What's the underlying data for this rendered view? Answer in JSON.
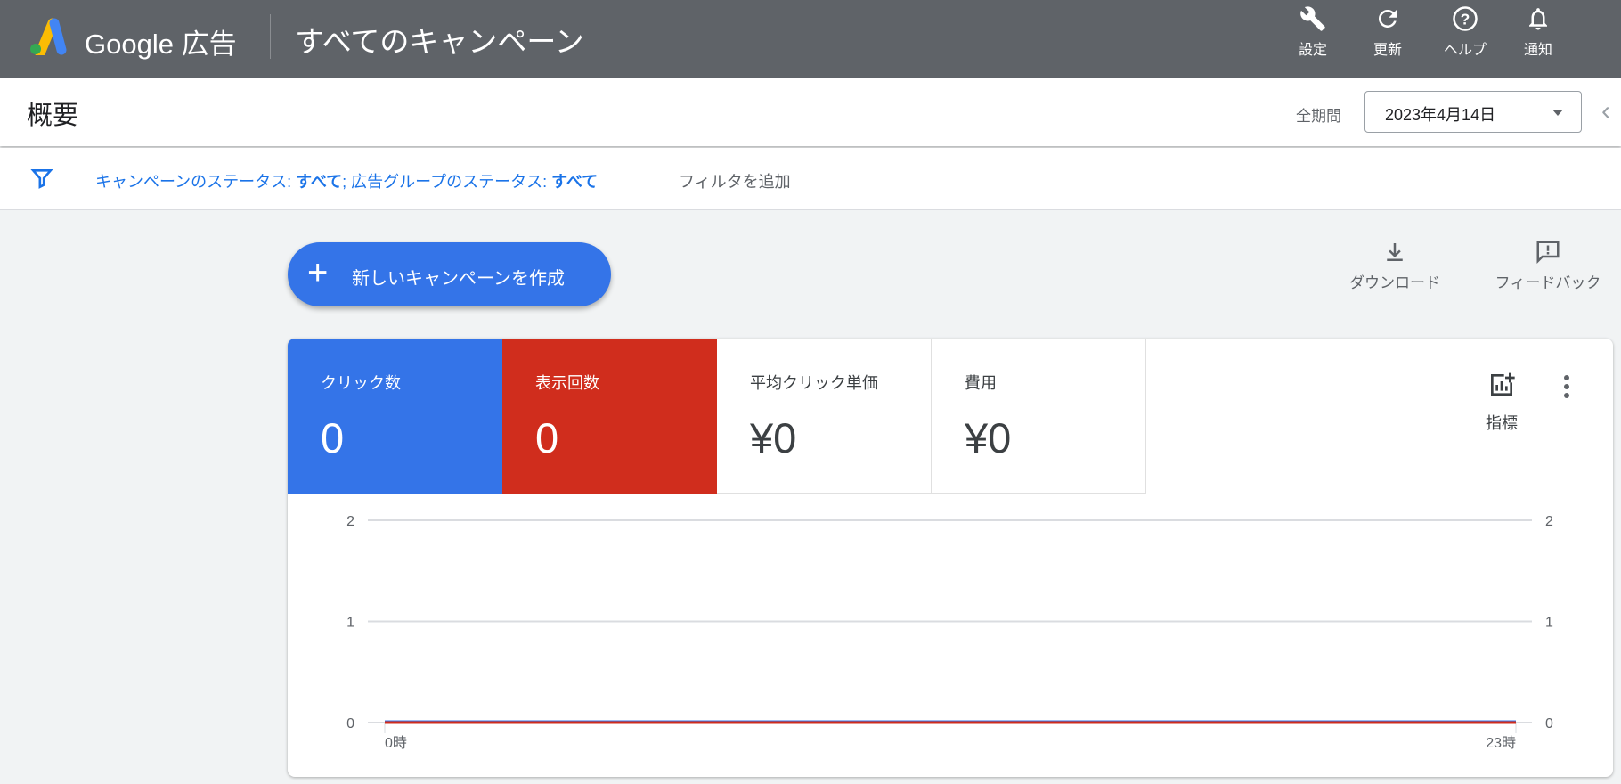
{
  "header": {
    "brand": "Google 広告",
    "title": "すべてのキャンペーン",
    "actions": [
      {
        "label": "設定",
        "icon": "wrench-icon"
      },
      {
        "label": "更新",
        "icon": "refresh-icon"
      },
      {
        "label": "ヘルプ",
        "icon": "help-icon"
      },
      {
        "label": "通知",
        "icon": "bell-icon"
      }
    ]
  },
  "subheader": {
    "title": "概要",
    "period_label": "全期間",
    "date": "2023年4月14日"
  },
  "filter": {
    "campaign_label": "キャンペーンのステータス: ",
    "campaign_value": "すべて",
    "sep": "; ",
    "adgroup_label": "広告グループのステータス: ",
    "adgroup_value": "すべて",
    "add_filter": "フィルタを追加"
  },
  "toolbar": {
    "new_campaign": "新しいキャンペーンを作成",
    "download": "ダウンロード",
    "feedback": "フィードバック"
  },
  "tiles": [
    {
      "label": "クリック数",
      "value": "0",
      "color": "#3474e8"
    },
    {
      "label": "表示回数",
      "value": "0",
      "color": "#d02d1d"
    },
    {
      "label": "平均クリック単価",
      "value": "¥0"
    },
    {
      "label": "費用",
      "value": "¥0"
    }
  ],
  "metrics_label": "指標",
  "chart_data": {
    "type": "line",
    "x": [
      "0時",
      "23時"
    ],
    "x_ticks": [
      "0時",
      "23時"
    ],
    "y_ticks": [
      "0",
      "1",
      "2"
    ],
    "ylim": [
      0,
      2
    ],
    "series": [
      {
        "name": "クリック数",
        "values": [
          0,
          0
        ],
        "color": "#3474e8"
      },
      {
        "name": "表示回数",
        "values": [
          0,
          0
        ],
        "color": "#d02d1d"
      }
    ],
    "grid": true
  }
}
